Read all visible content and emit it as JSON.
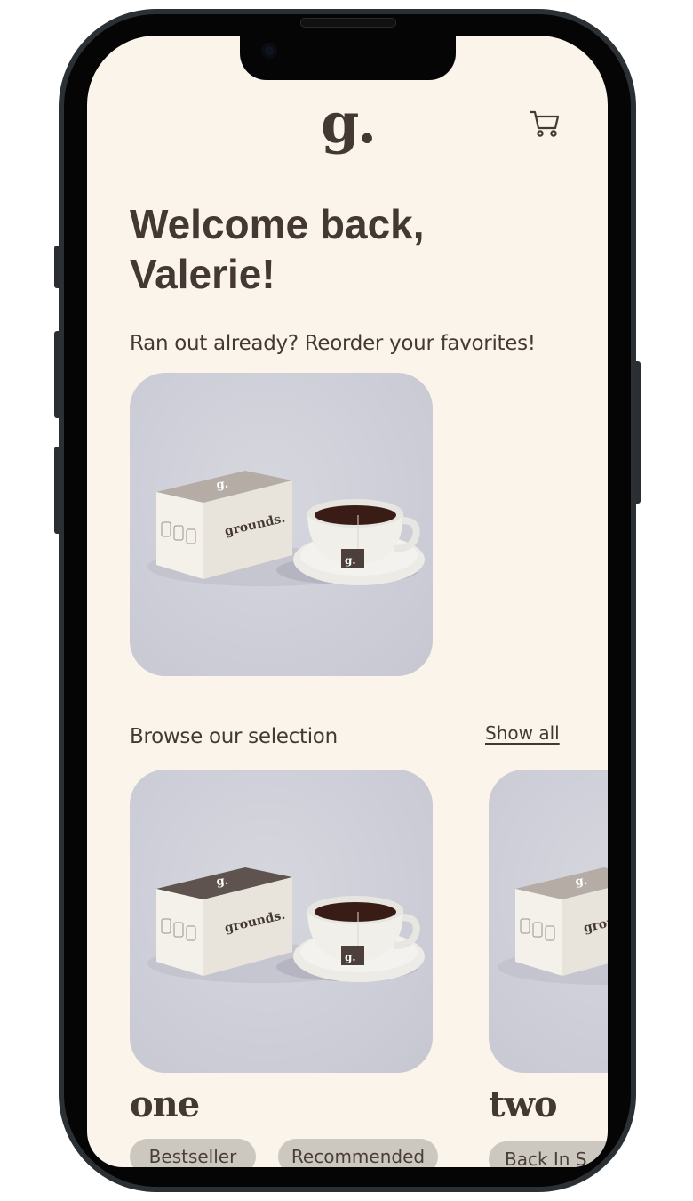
{
  "header": {
    "logo_text": "g.",
    "cart_icon": "shopping-cart-icon"
  },
  "greeting": {
    "line1": "Welcome back,",
    "line2": "Valerie!"
  },
  "reorder": {
    "prompt": "Ran out already? Reorder your favorites!",
    "product": {
      "box_brand": "grounds.",
      "box_logo": "g.",
      "teabag_logo": "g."
    }
  },
  "browse": {
    "title": "Browse our selection",
    "show_all": "Show all",
    "products": [
      {
        "name": "one",
        "box_brand": "grounds.",
        "box_logo": "g.",
        "teabag_logo": "g.",
        "tags": [
          "Bestseller",
          "Recommended"
        ]
      },
      {
        "name": "two",
        "box_brand": "grou",
        "box_logo": "g.",
        "tags": [
          "Back In S"
        ]
      }
    ]
  },
  "colors": {
    "background": "#faf4ea",
    "text": "#443832",
    "card": "#cdced8",
    "tag": "#ccc8bf",
    "box_top_dark": "#5e534e",
    "box_top_light": "#b5aca5"
  }
}
